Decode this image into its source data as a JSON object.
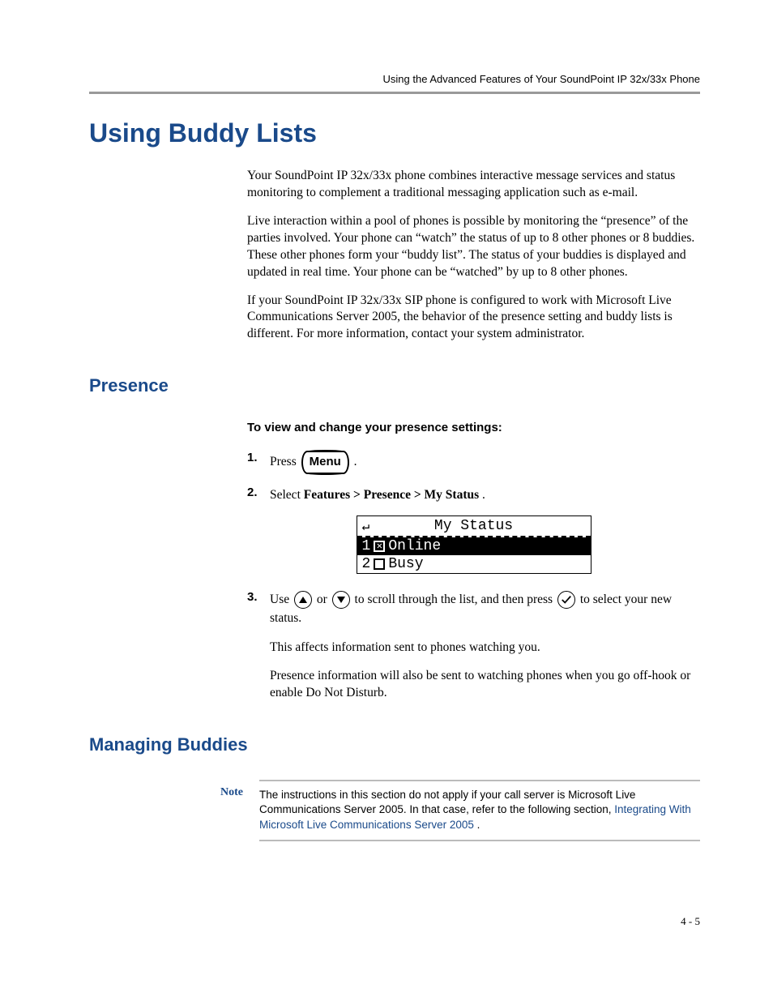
{
  "header": "Using the Advanced Features of Your SoundPoint IP 32x/33x Phone",
  "h1": "Using Buddy Lists",
  "intro": {
    "p1": "Your SoundPoint IP 32x/33x phone combines interactive message services and status monitoring to complement a traditional messaging application such as e-mail.",
    "p2": "Live interaction within a pool of phones is possible by monitoring the “presence” of the parties involved. Your phone can “watch” the status of up to 8 other phones or 8 buddies. These other phones form your “buddy list”. The status of your buddies is displayed and updated in real time. Your phone can be “watched” by up to 8 other phones.",
    "p3": "If your SoundPoint IP 32x/33x SIP phone is configured to work with Microsoft Live Communications Server 2005, the behavior of the presence setting and buddy lists is different. For more information, contact your system administrator."
  },
  "presence": {
    "heading": "Presence",
    "subhead": "To view and change your presence settings:",
    "steps": {
      "s1": {
        "num": "1.",
        "pre": "Press ",
        "key": "Menu",
        "post": " ."
      },
      "s2": {
        "num": "2.",
        "pre": "Select ",
        "bold": "Features > Presence > My Status",
        "post": "."
      },
      "s3": {
        "num": "3.",
        "t1": "Use ",
        "t2": " or ",
        "t3": " to scroll through the list, and then press ",
        "t4": " to select your new status."
      },
      "s3p2": "This affects information sent to phones watching you.",
      "s3p3": "Presence information will also be sent to watching phones when you go off-hook or enable Do Not Disturb."
    },
    "lcd": {
      "title": "My Status",
      "rows": [
        {
          "num": "1",
          "checked": true,
          "label": "Online",
          "selected": true
        },
        {
          "num": "2",
          "checked": false,
          "label": "Busy",
          "selected": false
        }
      ]
    }
  },
  "managing": {
    "heading": "Managing Buddies",
    "note": {
      "label": "Note",
      "text": "The instructions in this section do not apply if your call server is Microsoft Live Communications Server 2005. In that case, refer to the following section, ",
      "link": "Integrating With Microsoft Live Communications Server 2005",
      "post": "."
    }
  },
  "footer": "4 - 5"
}
